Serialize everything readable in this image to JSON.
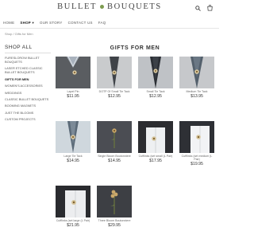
{
  "header": {
    "logo_left": "BULLET",
    "logo_right": "BOUQUETS"
  },
  "nav": [
    "HOME",
    "SHOP",
    "OUR STORY",
    "CONTACT US",
    "FAQ"
  ],
  "breadcrumb": "Shop / Gifts for Men",
  "sidebar": {
    "title": "SHOP ALL",
    "items": [
      "Fureslorow Bullet Bouquets",
      "Laser Etched Classic Bullet Bouquets",
      "Gifts for Men",
      "Women's Accessories",
      "Weddings",
      "Classic Bullet Bouquets",
      "Booming Magnets",
      "Just the Blooms",
      "Custom Projects"
    ]
  },
  "page_title": "GIFTS FOR MEN",
  "products": [
    {
      "name": "Lapel Pin",
      "price": "$11.95"
    },
    {
      "name": "DOTP Of Small Tie Tack",
      "price": "$12.95"
    },
    {
      "name": "Small Tie Tack",
      "price": "$12.95"
    },
    {
      "name": "Medium Tie Tack",
      "price": "$13.95"
    },
    {
      "name": "Large Tie Tack",
      "price": "$14.95"
    },
    {
      "name": "Single Bloom Boutonniere",
      "price": "$14.95"
    },
    {
      "name": "Cufflinks (set small (L Pair)",
      "price": "$17.95"
    },
    {
      "name": "Cufflinks (set medium (L Pair)",
      "price": "$19.95"
    },
    {
      "name": "Cufflinks (set large (L Pair)",
      "price": "$21.95"
    },
    {
      "name": "Three Bloom Boutonniere",
      "price": "$29.95"
    }
  ]
}
